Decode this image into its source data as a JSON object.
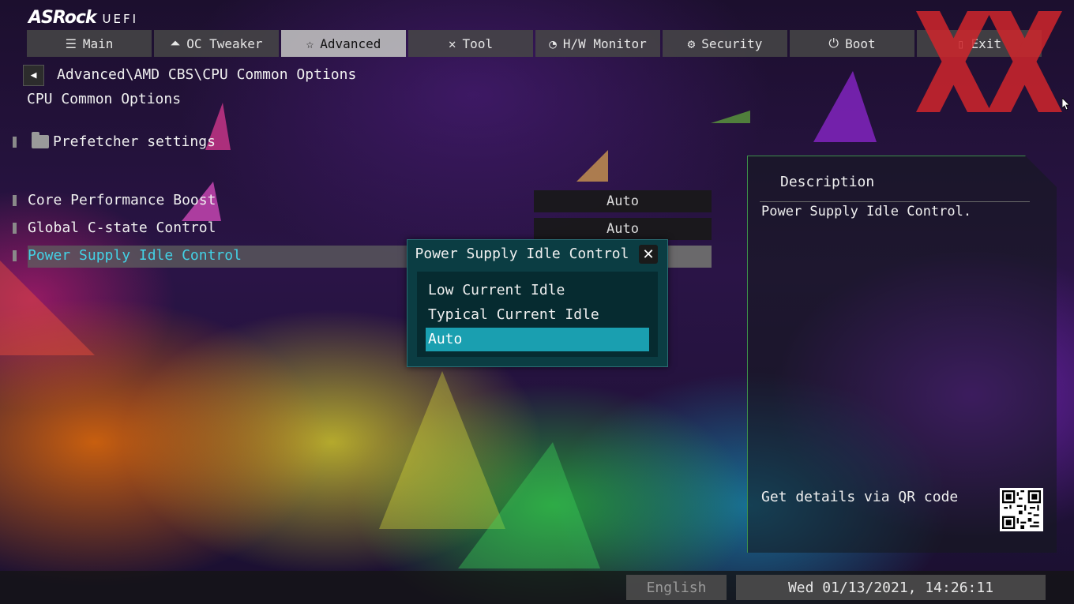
{
  "header": {
    "logo_brand": "ASRock",
    "logo_product": "UEFI",
    "tabs": [
      {
        "label": "Main",
        "icon": "list-icon"
      },
      {
        "label": "OC Tweaker",
        "icon": "rocket-icon"
      },
      {
        "label": "Advanced",
        "icon": "star-icon",
        "active": true
      },
      {
        "label": "Tool",
        "icon": "tools-icon"
      },
      {
        "label": "H/W Monitor",
        "icon": "monitor-gauge-icon"
      },
      {
        "label": "Security",
        "icon": "shield-gear-icon"
      },
      {
        "label": "Boot",
        "icon": "power-icon"
      },
      {
        "label": "Exit",
        "icon": "exit-door-icon"
      }
    ]
  },
  "breadcrumb": "Advanced\\AMD CBS\\CPU Common Options",
  "page_title": "CPU Common Options",
  "items": {
    "prefetcher": "Prefetcher settings",
    "core_boost": {
      "label": "Core Performance Boost",
      "value": "Auto"
    },
    "cstate": {
      "label": "Global C-state Control",
      "value": "Auto"
    },
    "psic": {
      "label": "Power Supply Idle Control",
      "value": "Auto"
    }
  },
  "popup": {
    "title": "Power Supply Idle Control",
    "options": [
      "Low Current Idle",
      "Typical Current Idle",
      "Auto"
    ],
    "selected": "Auto"
  },
  "description": {
    "title": "Description",
    "text": "Power Supply Idle Control.",
    "qr_label": "Get details via QR code"
  },
  "footer": {
    "language": "English",
    "datetime": "Wed 01/13/2021, 14:26:11"
  },
  "colors": {
    "accent": "#1a9fb0",
    "highlight_text": "#43d2e6",
    "popup_bg": "#0b3d43",
    "watermark": "#d0262c"
  }
}
